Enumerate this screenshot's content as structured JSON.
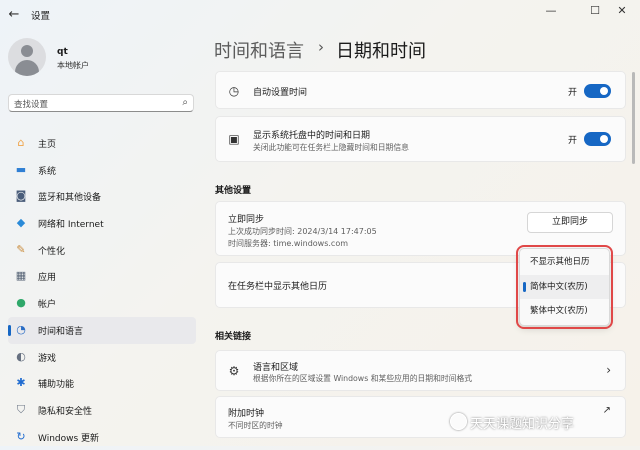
{
  "window": {
    "back_icon": "back-arrow-icon",
    "title": "设置",
    "controls": [
      "minimize-icon",
      "maximize-icon",
      "close-icon"
    ]
  },
  "profile": {
    "name": "qt",
    "account_type": "本地帐户"
  },
  "search": {
    "placeholder": "查找设置",
    "icon": "search-icon"
  },
  "sidebar": {
    "items": [
      {
        "label": "主页",
        "icon": "home-icon",
        "color": "#f0a44a"
      },
      {
        "label": "系统",
        "icon": "monitor-icon",
        "color": "#2f7fd4"
      },
      {
        "label": "蓝牙和其他设备",
        "icon": "bluetooth-devices-icon",
        "color": "#4a5d7a"
      },
      {
        "label": "网络和 Internet",
        "icon": "wifi-icon",
        "color": "#2a8ad8"
      },
      {
        "label": "个性化",
        "icon": "brush-icon",
        "color": "#c98a3a"
      },
      {
        "label": "应用",
        "icon": "apps-icon",
        "color": "#556274"
      },
      {
        "label": "帐户",
        "icon": "account-icon",
        "color": "#2fa86a"
      },
      {
        "label": "时间和语言",
        "icon": "globe-clock-icon",
        "color": "#2a6cc4",
        "active": true
      },
      {
        "label": "游戏",
        "icon": "game-controller-icon",
        "color": "#667080"
      },
      {
        "label": "辅助功能",
        "icon": "accessibility-icon",
        "color": "#1f6bd0"
      },
      {
        "label": "隐私和安全性",
        "icon": "shield-icon",
        "color": "#6b7585"
      },
      {
        "label": "Windows 更新",
        "icon": "windows-update-icon",
        "color": "#1f6bd0"
      }
    ]
  },
  "breadcrumb": {
    "parent": "时间和语言",
    "separator": "›",
    "current": "日期和时间"
  },
  "settings": {
    "auto_time": {
      "label": "自动设置时间",
      "state_label": "开",
      "on": true,
      "icon": "clock-icon"
    },
    "show_tray_time": {
      "label": "显示系统托盘中的时间和日期",
      "description": "关闭此功能可在任务栏上隐藏时间和日期信息",
      "state_label": "开",
      "on": true,
      "icon": "calendar-clock-icon"
    }
  },
  "other_settings": {
    "heading": "其他设置",
    "sync": {
      "title": "立即同步",
      "last_sync": "上次成功同步时间: 2024/3/14 17:47:05",
      "server": "时间服务器: time.windows.com",
      "button_label": "立即同步"
    },
    "calendar": {
      "label": "在任务栏中显示其他日历",
      "options": [
        "不显示其他日历",
        "简体中文(农历)",
        "繁体中文(农历)"
      ],
      "selected": "简体中文(农历)"
    }
  },
  "related_links": {
    "heading": "相关链接",
    "language_region": {
      "title": "语言和区域",
      "description": "根据你所在的区域设置 Windows 和某些应用的日期和时间格式",
      "icon": "language-region-icon"
    },
    "additional_clocks": {
      "title": "附加时钟",
      "description": "不同时区的时钟",
      "icon": "external-link-icon"
    }
  },
  "watermark": {
    "text": "天天课题知识分享"
  },
  "colors": {
    "accent": "#1667c4",
    "highlight_border": "#e04848"
  }
}
